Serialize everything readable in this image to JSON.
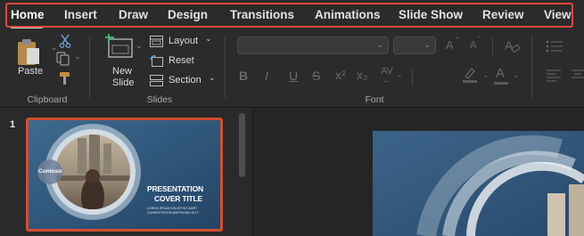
{
  "tabs": {
    "home": "Home",
    "insert": "Insert",
    "draw": "Draw",
    "design": "Design",
    "transitions": "Transitions",
    "animations": "Animations",
    "slide_show": "Slide Show",
    "review": "Review",
    "view": "View"
  },
  "clipboard": {
    "paste_label": "Paste",
    "group_label": "Clipboard"
  },
  "slides": {
    "new_slide_line1": "New",
    "new_slide_line2": "Slide",
    "layout_label": "Layout",
    "reset_label": "Reset",
    "section_label": "Section",
    "group_label": "Slides"
  },
  "font": {
    "group_label": "Font",
    "bold": "B",
    "italic": "I",
    "underline": "U",
    "strike": "S",
    "superscript": "x²",
    "subscript": "x₂",
    "spacing": "AV",
    "color_a": "A",
    "grow": "A",
    "shrink": "A"
  },
  "thumbnail": {
    "slide_number": "1",
    "logo_text": "Contoso",
    "title_line1": "PRESENTATION",
    "title_line2": "COVER TITLE",
    "sub_line1": "LOREM IPSUM DOLOR SIT AMET",
    "sub_line2": "CONSECTETUR ADIPISCING ELIT"
  },
  "colors": {
    "highlight_border": "#e0483e",
    "selected_thumb_border": "#d0502f",
    "slide_blue": "#2f4f72"
  }
}
